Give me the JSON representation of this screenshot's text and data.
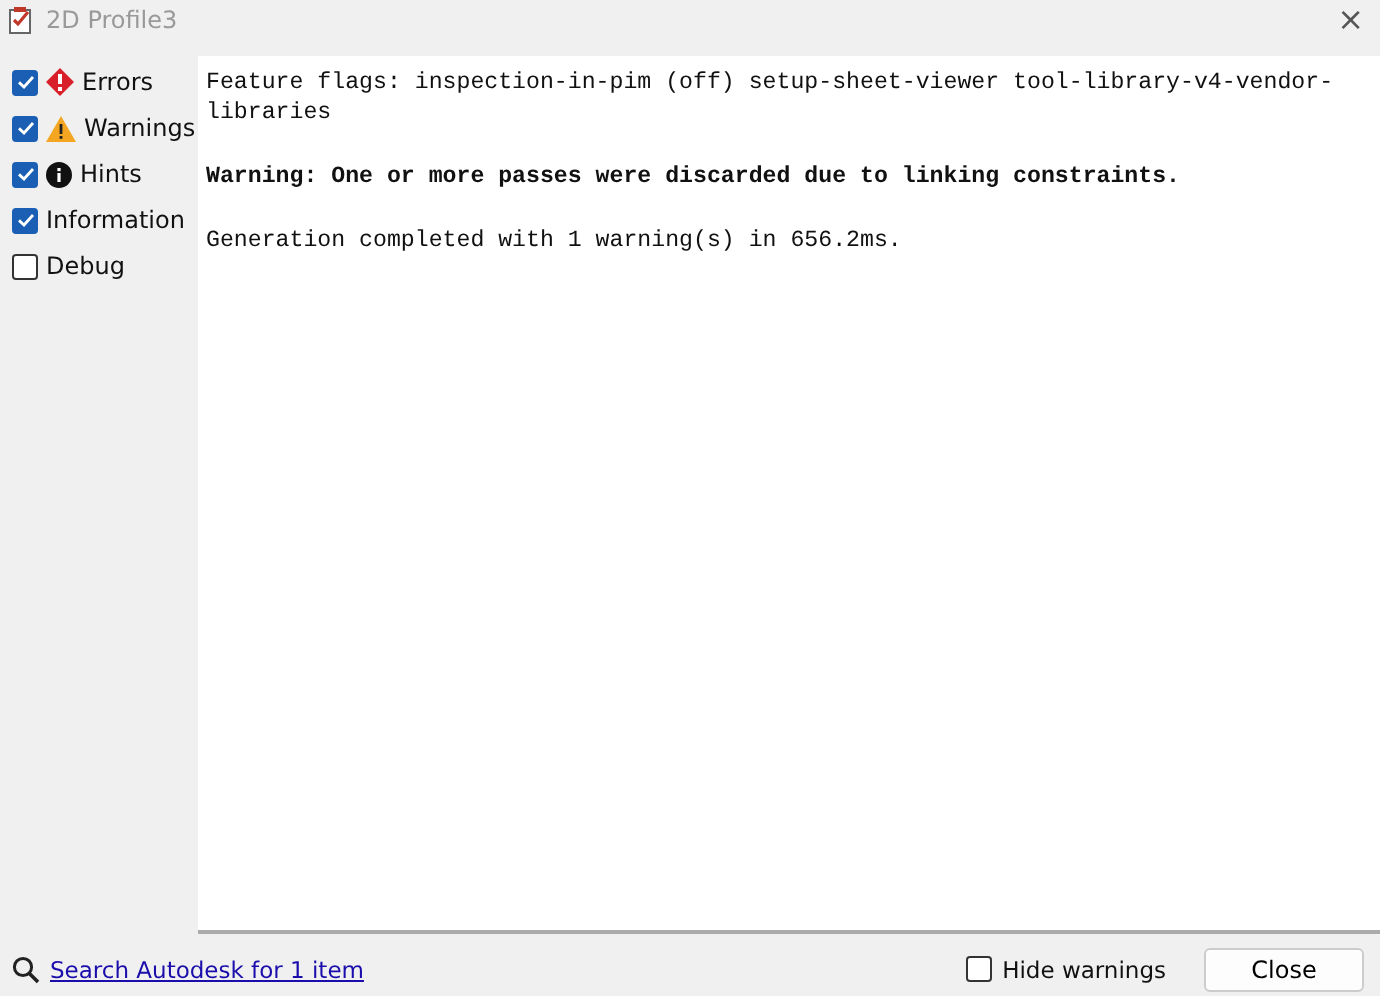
{
  "window": {
    "title": "2D Profile3",
    "close": "×"
  },
  "filters": [
    {
      "label": "Errors",
      "kind": "error",
      "checked": true
    },
    {
      "label": "Warnings",
      "kind": "warning",
      "checked": true
    },
    {
      "label": "Hints",
      "kind": "hint",
      "checked": true
    },
    {
      "label": "Information",
      "kind": "plain",
      "checked": true
    },
    {
      "label": "Debug",
      "kind": "plain",
      "checked": false
    }
  ],
  "messages": [
    {
      "text": "Feature flags: inspection-in-pim (off) setup-sheet-viewer tool-library-v4-vendor-libraries",
      "kind": "info"
    },
    {
      "text": "Warning: One or more passes were discarded due to linking constraints.",
      "kind": "warning"
    },
    {
      "text": "Generation completed with 1 warning(s) in 656.2ms.",
      "kind": "info"
    }
  ],
  "footer": {
    "search_link": "Search Autodesk for 1 item",
    "hide_warnings": {
      "label": "Hide warnings",
      "checked": false
    },
    "button": "Close"
  }
}
